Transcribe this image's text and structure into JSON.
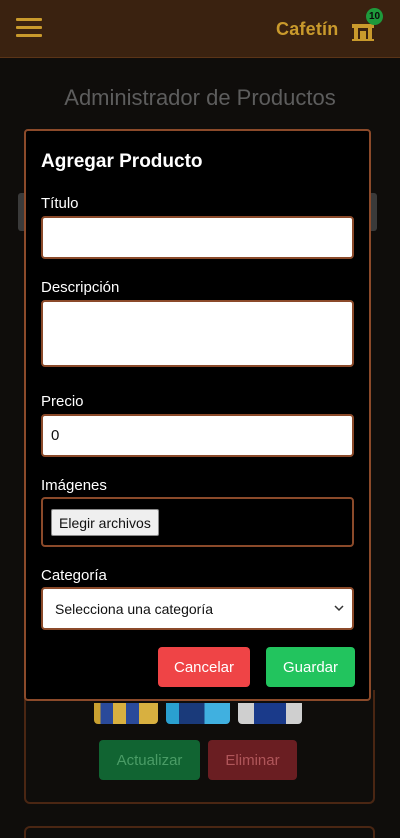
{
  "navbar": {
    "brand": "Cafetín",
    "cart_count": "10",
    "menu_icon": "hamburger-menu-icon",
    "cart_icon": "shop-icon"
  },
  "page": {
    "title": "Administrador de Productos"
  },
  "background_card": {
    "update_label": "Actualizar",
    "delete_label": "Eliminar"
  },
  "modal": {
    "title": "Agregar Producto",
    "fields": {
      "title_label": "Título",
      "title_value": "",
      "description_label": "Descripción",
      "description_value": "",
      "price_label": "Precio",
      "price_value": "0",
      "images_label": "Imágenes",
      "images_button": "Elegir archivos",
      "category_label": "Categoría",
      "category_selected": "Selecciona una categoría"
    },
    "cancel_label": "Cancelar",
    "save_label": "Guardar"
  },
  "colors": {
    "navbar_bg": "#3a2210",
    "brand": "#c99a2c",
    "modal_border": "#8b4a2a",
    "cancel": "#ef4446",
    "save": "#22c45e",
    "badge": "#1e9a3c"
  }
}
